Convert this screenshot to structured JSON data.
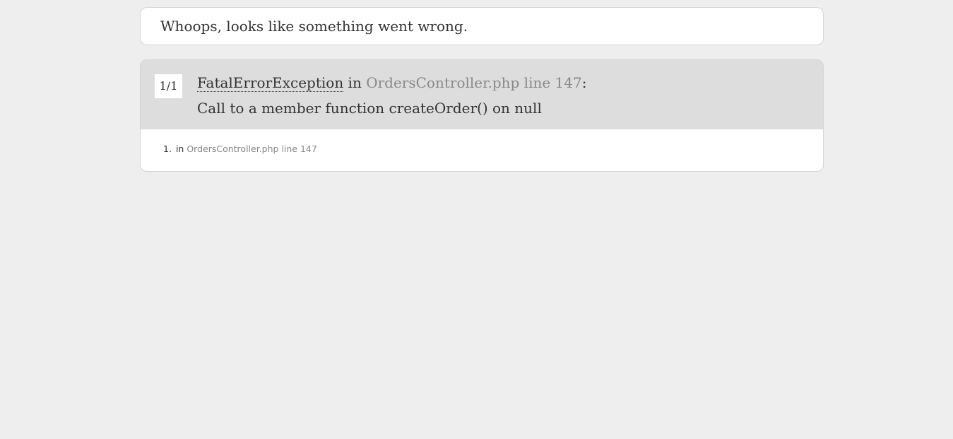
{
  "header": {
    "title": "Whoops, looks like something went wrong."
  },
  "exception": {
    "counter": "1/1",
    "class_name": "FatalErrorException",
    "in_word": " in ",
    "file": "OrdersController.php line 147",
    "colon": ":",
    "message": "Call to a member function createOrder() on null"
  },
  "trace": [
    {
      "number": "1.",
      "in_word": "in",
      "file": "OrdersController.php line 147"
    }
  ],
  "colors": {
    "page_background": "#eeeeee",
    "header_background": "#dddddd",
    "muted_text": "#888888",
    "text": "#333333"
  }
}
